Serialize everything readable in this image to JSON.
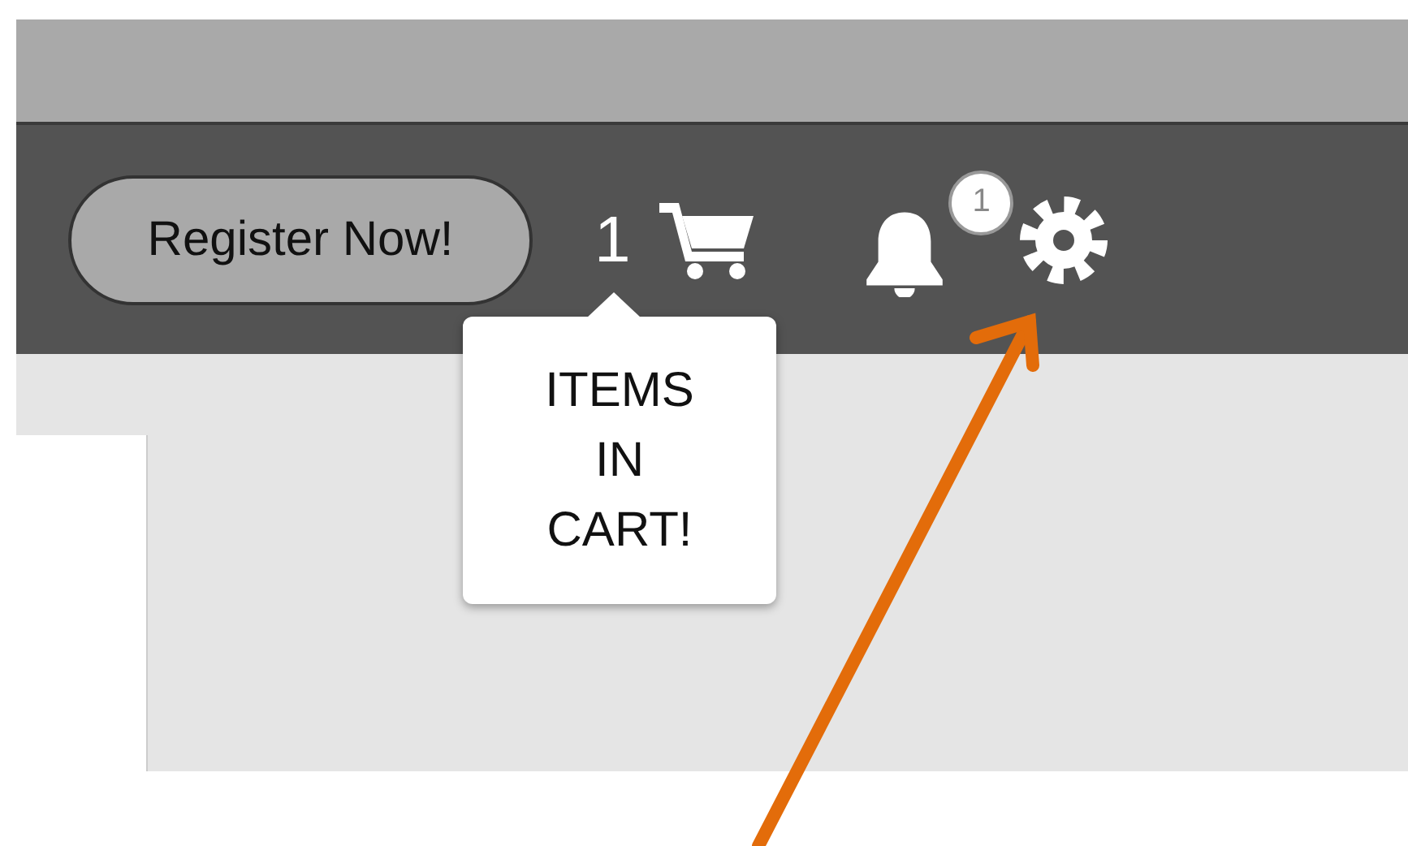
{
  "header": {
    "register_button": "Register Now!",
    "cart_count": "1",
    "notification_badge": "1"
  },
  "tooltip": {
    "text": "ITEMS IN CART!"
  }
}
